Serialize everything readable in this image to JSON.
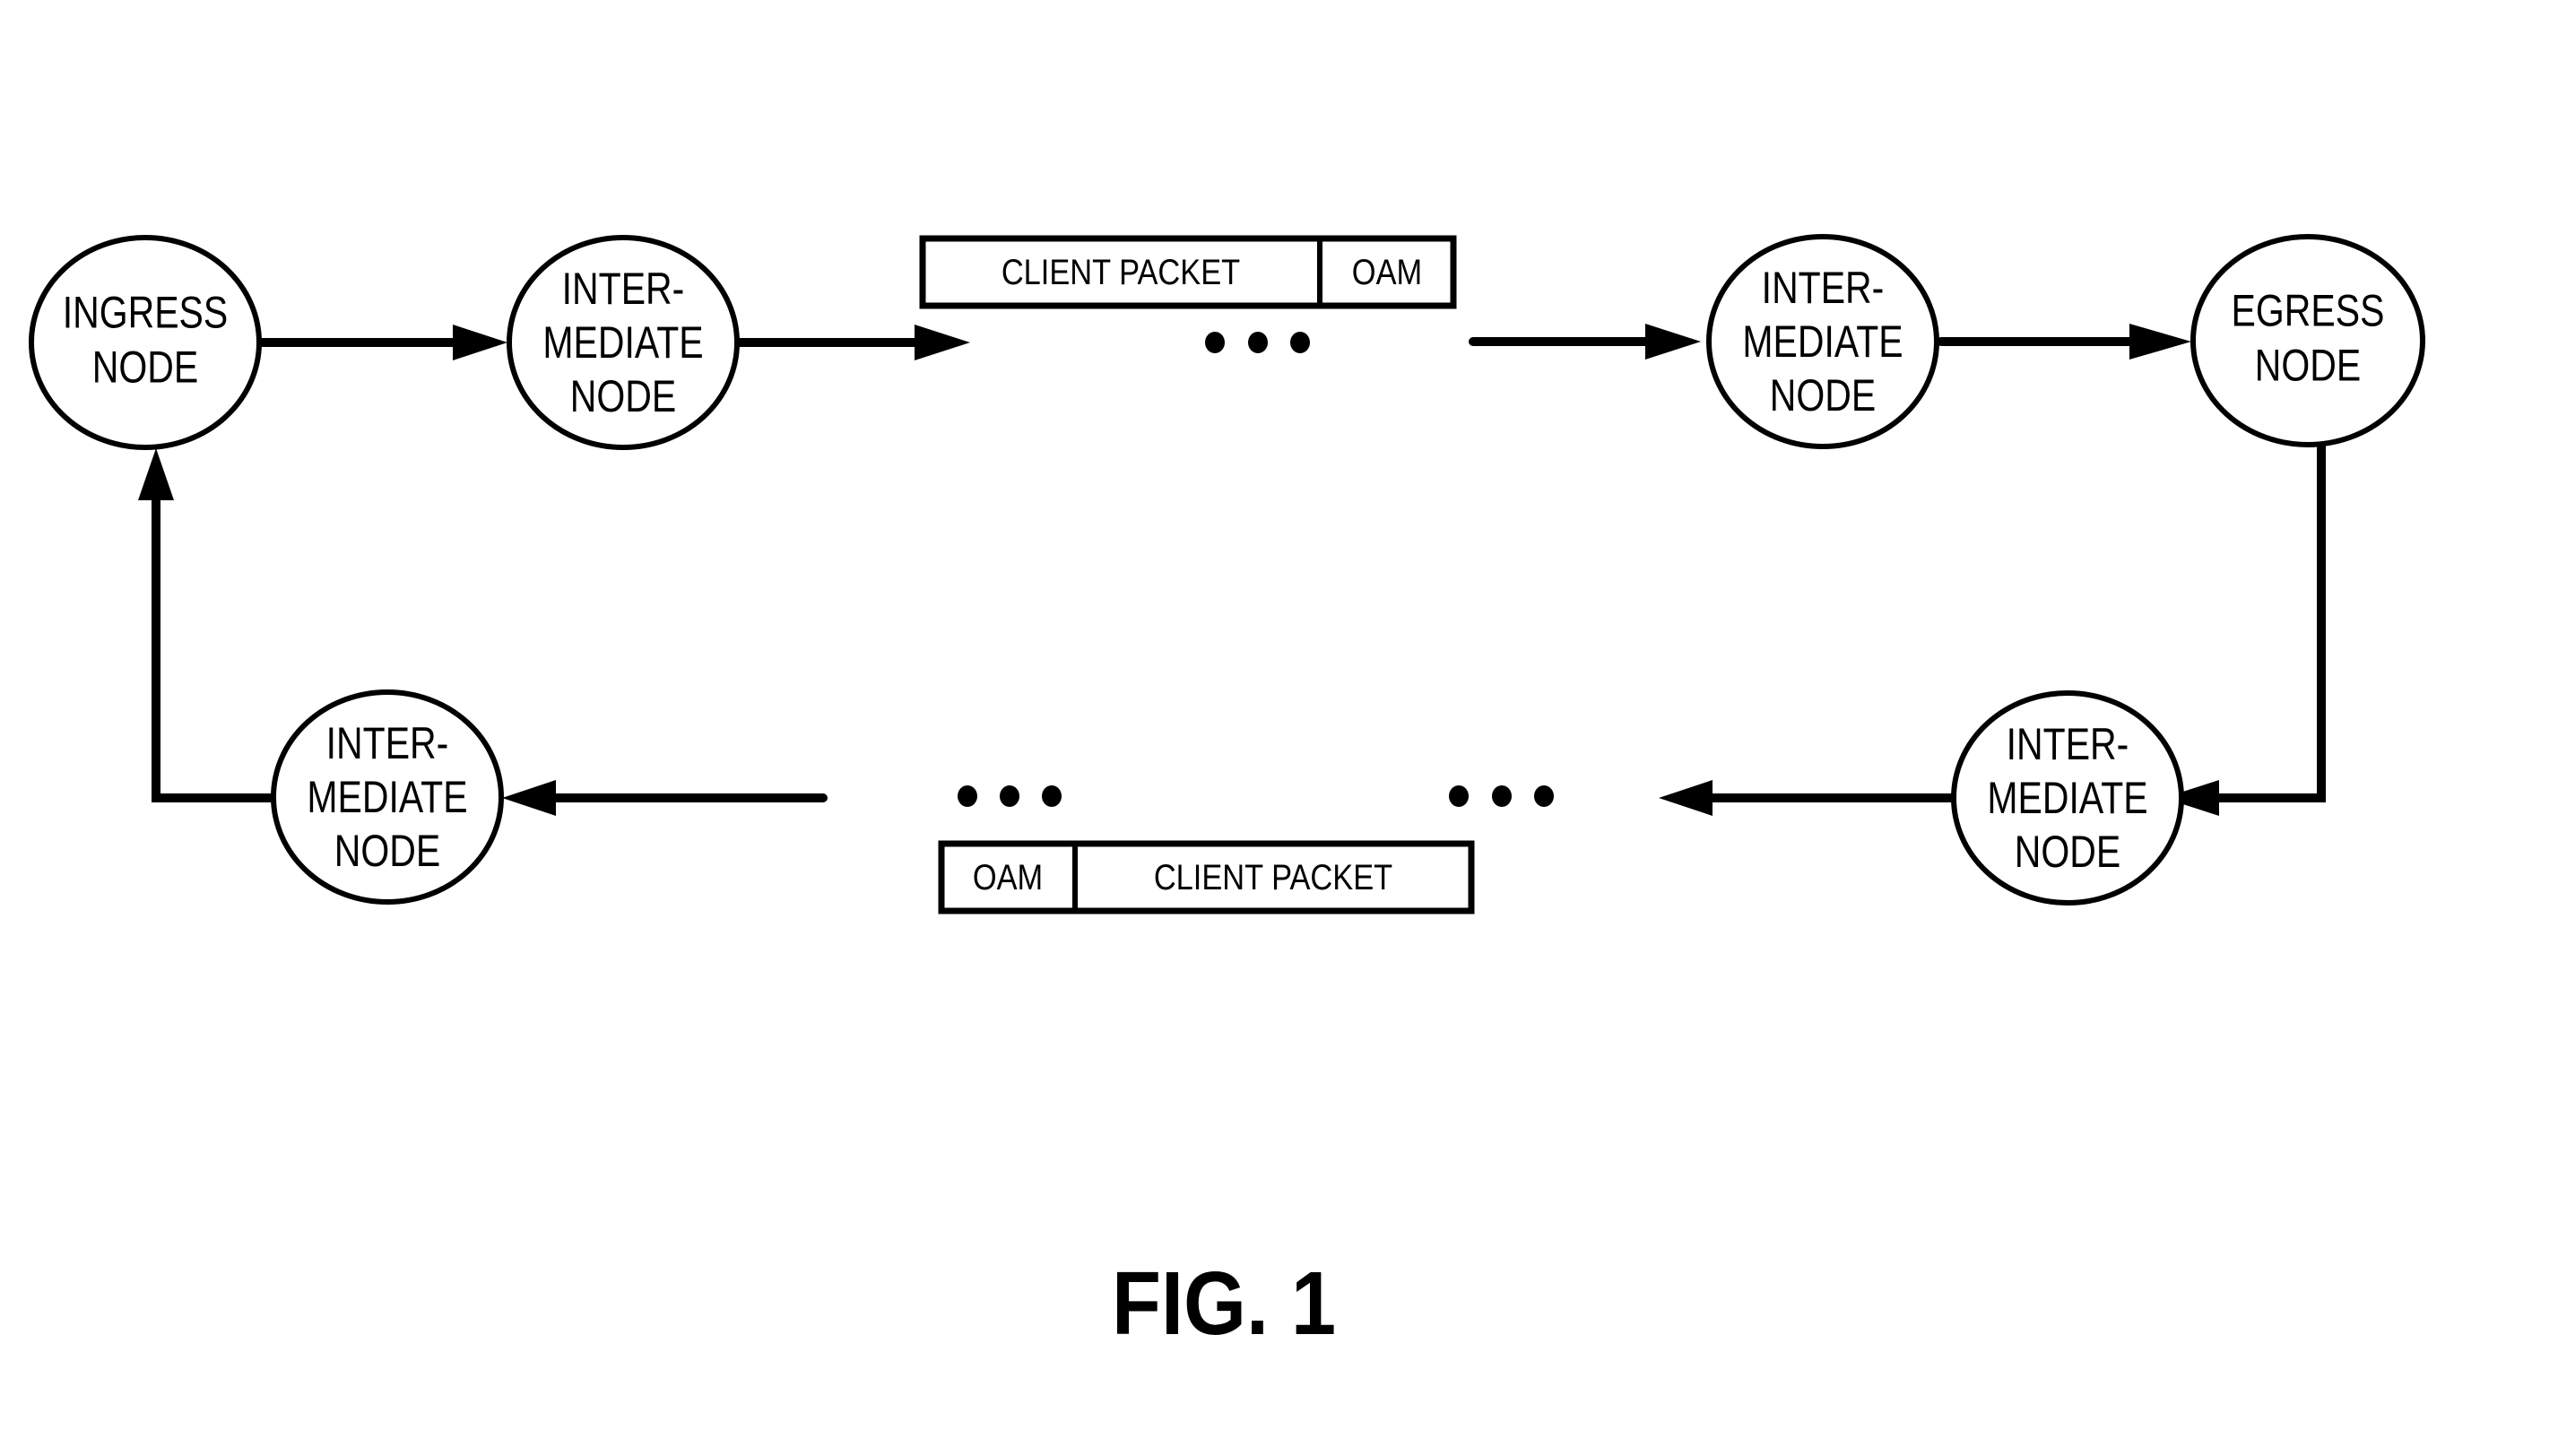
{
  "figure": {
    "caption": "FIG. 1",
    "nodes": [
      {
        "id": "ingress",
        "lines": [
          "INGRESS",
          "NODE"
        ]
      },
      {
        "id": "intermediate-1",
        "lines": [
          "INTER-",
          "MEDIATE",
          "NODE"
        ]
      },
      {
        "id": "intermediate-2",
        "lines": [
          "INTER-",
          "MEDIATE",
          "NODE"
        ]
      },
      {
        "id": "egress",
        "lines": [
          "EGRESS",
          "NODE"
        ]
      },
      {
        "id": "intermediate-3",
        "lines": [
          "INTER-",
          "MEDIATE",
          "NODE"
        ]
      },
      {
        "id": "intermediate-4",
        "lines": [
          "INTER-",
          "MEDIATE",
          "NODE"
        ]
      }
    ],
    "edges": [
      {
        "from": "ingress",
        "to": "intermediate-1",
        "direction": "forward"
      },
      {
        "from": "intermediate-1",
        "to": "ellipsis-top",
        "direction": "forward"
      },
      {
        "from": "ellipsis-top",
        "to": "intermediate-2",
        "direction": "forward"
      },
      {
        "from": "intermediate-2",
        "to": "egress",
        "direction": "forward"
      },
      {
        "from": "egress",
        "to": "intermediate-3",
        "direction": "return"
      },
      {
        "from": "intermediate-3",
        "to": "ellipsis-bottom-right",
        "direction": "return"
      },
      {
        "from": "ellipsis-bottom-left",
        "to": "intermediate-4",
        "direction": "return"
      },
      {
        "from": "intermediate-4",
        "to": "ingress",
        "direction": "return"
      }
    ],
    "packets": {
      "forward": {
        "fields": [
          "CLIENT PACKET",
          "OAM"
        ]
      },
      "return": {
        "fields": [
          "OAM",
          "CLIENT PACKET"
        ]
      }
    },
    "ellipsis": "• • •"
  }
}
